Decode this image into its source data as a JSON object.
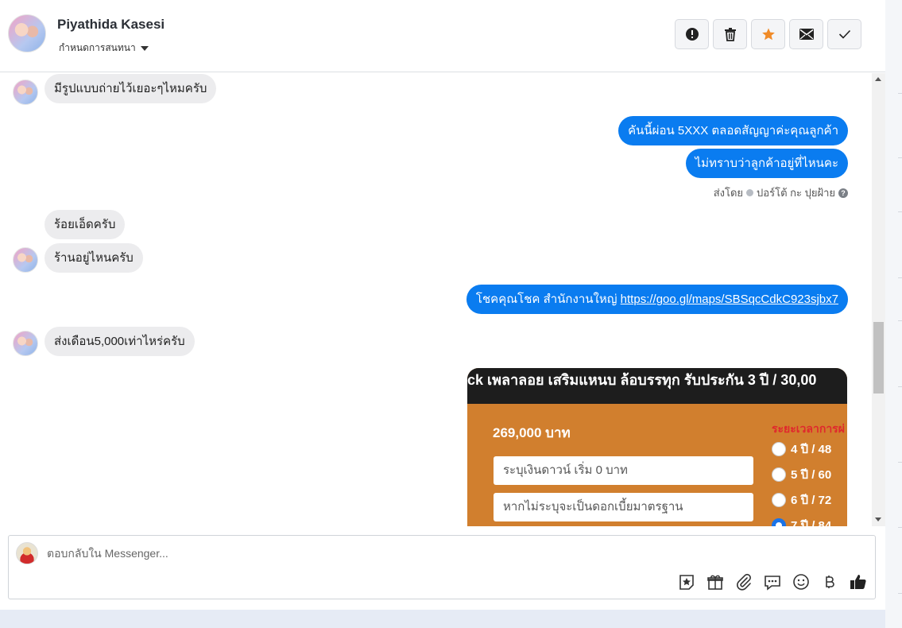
{
  "header": {
    "contact_name": "Piyathida Kasesi",
    "conversation_menu": "กำหนดการสนทนา",
    "actions": [
      "spam",
      "delete",
      "star",
      "mark-unread",
      "done"
    ],
    "star_color": "#f08b28"
  },
  "messages": {
    "m1": "มีรูปแบบถ่ายไว้เยอะๆไหมครับ",
    "m2": "คันนี้ผ่อน 5XXX  ตลอดสัญญาค่ะคุณลูกค้า",
    "m3": "ไม่ทราบว่าลูกค้าอยู่ที่ไหนคะ",
    "sent_by_label": "ส่งโดย",
    "sent_by_name": "ปอร์โต้ กะ ปุยฝ้าย",
    "help_mark": "?",
    "m4": "ร้อยเอ็ดครับ",
    "m5": "ร้านอยู่ไหนครับ",
    "m6_text": "โชคคุณโชค สำนักงานใหญ่ ",
    "m6_link": "https://goo.gl/maps/SBSqcCdkC923sjbx7",
    "m7": "ส่งเดือน5,000เท่าไหร่ครับ"
  },
  "attachment": {
    "banner": "ck เพลาลอย เสริมแหนบ ล้อบรรทุก รับประกัน 3 ปี / 30,00",
    "price": "269,000 บาท",
    "down_payment_placeholder": "ระบุเงินดาวน์ เริ่ม 0 บาท",
    "interest_placeholder": "หากไม่ระบุจะเป็นดอกเบี้ยมาตรฐาน",
    "period_title": "ระยะเวลาการผ่",
    "options": [
      "4 ปี / 48",
      "5 ปี / 60",
      "6 ปี / 72",
      "7 ปี / 84"
    ],
    "selected_option": 3
  },
  "composer": {
    "placeholder": "ตอบกลับใน Messenger...",
    "tools": [
      "sticker-icon",
      "gift-icon",
      "attachment-icon",
      "saved-reply-icon",
      "emoji-icon",
      "baht-icon",
      "like-icon"
    ]
  },
  "colors": {
    "outgoing_bubble": "#0a7cf0",
    "incoming_bubble": "#ececee"
  }
}
